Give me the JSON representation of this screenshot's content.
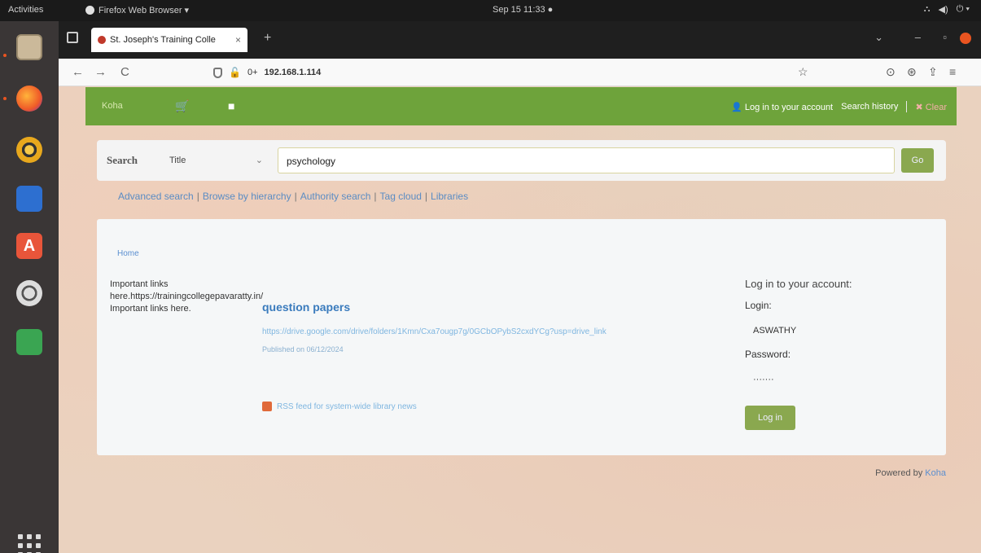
{
  "topbar": {
    "activities": "Activities",
    "app": "Firefox Web Browser ▾",
    "clock": "Sep 15 11:33 ●",
    "tray": [
      "⛬",
      "◀)",
      "⏻ ▾"
    ]
  },
  "browser": {
    "tab_title": "St. Joseph's Training Colle",
    "tab_close": "×",
    "new_tab": "+",
    "win_list": "⌄",
    "win_min": "–",
    "win_max": "▫",
    "back": "←",
    "forward": "→",
    "reload": "C",
    "url_prefix": "0+",
    "url": "192.168.1.114",
    "bookmark": "☆",
    "pocket": "⊙",
    "account": "⊛",
    "extensions": "⇪",
    "menu": "≡"
  },
  "header": {
    "brand": "Koha",
    "cart": "🛒",
    "lists": "■",
    "login_link": "👤 Log in to your account",
    "search_history": "Search history",
    "clear": "✖ Clear"
  },
  "search": {
    "label": "Search",
    "type": "Title",
    "chevron": "⌄",
    "query": "psychology",
    "go": "Go"
  },
  "moresearches": {
    "items": [
      "Advanced search",
      "Browse by hierarchy",
      "Authority search",
      "Tag cloud",
      "Libraries"
    ],
    "separator": "|"
  },
  "main": {
    "breadcrumb": "Home",
    "left_text": "Important links here.https://trainingcollegepavaratty.in/ Important links here.",
    "news": {
      "title": "question papers",
      "link": "https://drive.google.com/drive/folders/1Kmn/Cxa7ougp7g/0GCbOPybS2cxdYCg?usp=drive_link",
      "date": "Published on 06/12/2024"
    },
    "rss": "RSS feed for system-wide library news"
  },
  "login": {
    "title": "Log in to your account:",
    "login_label": "Login:",
    "login_value": "ASWATHY",
    "password_label": "Password:",
    "password_value": "·······",
    "button": "Log in"
  },
  "footer": {
    "powered_prefix": "Powered by",
    "koha": "Koha"
  }
}
